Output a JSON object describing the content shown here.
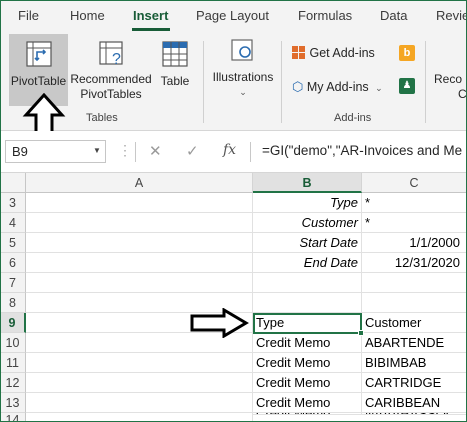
{
  "menu": {
    "tabs": [
      "File",
      "Home",
      "Insert",
      "Page Layout",
      "Formulas",
      "Data",
      "Revie"
    ],
    "active_tab": "Insert"
  },
  "ribbon": {
    "pivottable_label": "PivotTable",
    "recommended_label_1": "Recommended",
    "recommended_label_2": "PivotTables",
    "table_label": "Table",
    "tables_group": "Tables",
    "illustrations_label": "Illustrations",
    "get_addins_label": "Get Add-ins",
    "my_addins_label": "My Add-ins",
    "addins_group": "Add-ins",
    "recommended_charts_cut": "Reco",
    "recommended_charts_cut_2": "C"
  },
  "formula_bar": {
    "name_box": "B9",
    "fx_label": "fx",
    "formula": "=GI(\"demo\",\"AR-Invoices and Me"
  },
  "grid": {
    "columns": [
      "A",
      "B",
      "C"
    ],
    "rows": [
      {
        "num": "3",
        "b": "Type",
        "c": "*"
      },
      {
        "num": "4",
        "b": "Customer",
        "c": "*"
      },
      {
        "num": "5",
        "b": "Start Date",
        "c": "1/1/2000"
      },
      {
        "num": "6",
        "b": "End Date",
        "c": "12/31/2020"
      },
      {
        "num": "7",
        "b": "",
        "c": ""
      },
      {
        "num": "8",
        "b": "",
        "c": ""
      },
      {
        "num": "9",
        "b": "Type",
        "c": "Customer"
      },
      {
        "num": "10",
        "b": "Credit Memo",
        "c": "ABARTENDE"
      },
      {
        "num": "11",
        "b": "Credit Memo",
        "c": "BIBIMBAB"
      },
      {
        "num": "12",
        "b": "Credit Memo",
        "c": "CARTRIDGE"
      },
      {
        "num": "13",
        "b": "Credit Memo",
        "c": "CARIBBEAN"
      },
      {
        "num": "14",
        "b": "Credit Memo",
        "c": "NAAARASSOC"
      }
    ]
  },
  "colors": {
    "accent": "#217346",
    "active_tab": "#185c37"
  }
}
